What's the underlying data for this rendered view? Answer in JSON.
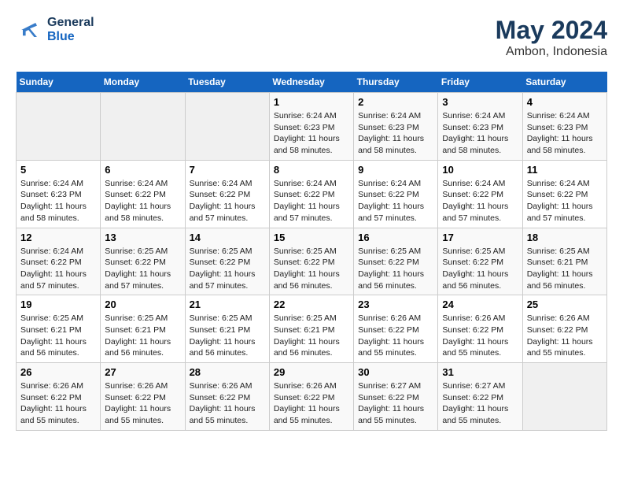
{
  "header": {
    "logo_general": "General",
    "logo_blue": "Blue",
    "title": "May 2024",
    "subtitle": "Ambon, Indonesia"
  },
  "weekdays": [
    "Sunday",
    "Monday",
    "Tuesday",
    "Wednesday",
    "Thursday",
    "Friday",
    "Saturday"
  ],
  "weeks": [
    [
      {
        "day": "",
        "info": ""
      },
      {
        "day": "",
        "info": ""
      },
      {
        "day": "",
        "info": ""
      },
      {
        "day": "1",
        "info": "Sunrise: 6:24 AM\nSunset: 6:23 PM\nDaylight: 11 hours and 58 minutes."
      },
      {
        "day": "2",
        "info": "Sunrise: 6:24 AM\nSunset: 6:23 PM\nDaylight: 11 hours and 58 minutes."
      },
      {
        "day": "3",
        "info": "Sunrise: 6:24 AM\nSunset: 6:23 PM\nDaylight: 11 hours and 58 minutes."
      },
      {
        "day": "4",
        "info": "Sunrise: 6:24 AM\nSunset: 6:23 PM\nDaylight: 11 hours and 58 minutes."
      }
    ],
    [
      {
        "day": "5",
        "info": "Sunrise: 6:24 AM\nSunset: 6:23 PM\nDaylight: 11 hours and 58 minutes."
      },
      {
        "day": "6",
        "info": "Sunrise: 6:24 AM\nSunset: 6:22 PM\nDaylight: 11 hours and 58 minutes."
      },
      {
        "day": "7",
        "info": "Sunrise: 6:24 AM\nSunset: 6:22 PM\nDaylight: 11 hours and 57 minutes."
      },
      {
        "day": "8",
        "info": "Sunrise: 6:24 AM\nSunset: 6:22 PM\nDaylight: 11 hours and 57 minutes."
      },
      {
        "day": "9",
        "info": "Sunrise: 6:24 AM\nSunset: 6:22 PM\nDaylight: 11 hours and 57 minutes."
      },
      {
        "day": "10",
        "info": "Sunrise: 6:24 AM\nSunset: 6:22 PM\nDaylight: 11 hours and 57 minutes."
      },
      {
        "day": "11",
        "info": "Sunrise: 6:24 AM\nSunset: 6:22 PM\nDaylight: 11 hours and 57 minutes."
      }
    ],
    [
      {
        "day": "12",
        "info": "Sunrise: 6:24 AM\nSunset: 6:22 PM\nDaylight: 11 hours and 57 minutes."
      },
      {
        "day": "13",
        "info": "Sunrise: 6:25 AM\nSunset: 6:22 PM\nDaylight: 11 hours and 57 minutes."
      },
      {
        "day": "14",
        "info": "Sunrise: 6:25 AM\nSunset: 6:22 PM\nDaylight: 11 hours and 57 minutes."
      },
      {
        "day": "15",
        "info": "Sunrise: 6:25 AM\nSunset: 6:22 PM\nDaylight: 11 hours and 56 minutes."
      },
      {
        "day": "16",
        "info": "Sunrise: 6:25 AM\nSunset: 6:22 PM\nDaylight: 11 hours and 56 minutes."
      },
      {
        "day": "17",
        "info": "Sunrise: 6:25 AM\nSunset: 6:22 PM\nDaylight: 11 hours and 56 minutes."
      },
      {
        "day": "18",
        "info": "Sunrise: 6:25 AM\nSunset: 6:21 PM\nDaylight: 11 hours and 56 minutes."
      }
    ],
    [
      {
        "day": "19",
        "info": "Sunrise: 6:25 AM\nSunset: 6:21 PM\nDaylight: 11 hours and 56 minutes."
      },
      {
        "day": "20",
        "info": "Sunrise: 6:25 AM\nSunset: 6:21 PM\nDaylight: 11 hours and 56 minutes."
      },
      {
        "day": "21",
        "info": "Sunrise: 6:25 AM\nSunset: 6:21 PM\nDaylight: 11 hours and 56 minutes."
      },
      {
        "day": "22",
        "info": "Sunrise: 6:25 AM\nSunset: 6:21 PM\nDaylight: 11 hours and 56 minutes."
      },
      {
        "day": "23",
        "info": "Sunrise: 6:26 AM\nSunset: 6:22 PM\nDaylight: 11 hours and 55 minutes."
      },
      {
        "day": "24",
        "info": "Sunrise: 6:26 AM\nSunset: 6:22 PM\nDaylight: 11 hours and 55 minutes."
      },
      {
        "day": "25",
        "info": "Sunrise: 6:26 AM\nSunset: 6:22 PM\nDaylight: 11 hours and 55 minutes."
      }
    ],
    [
      {
        "day": "26",
        "info": "Sunrise: 6:26 AM\nSunset: 6:22 PM\nDaylight: 11 hours and 55 minutes."
      },
      {
        "day": "27",
        "info": "Sunrise: 6:26 AM\nSunset: 6:22 PM\nDaylight: 11 hours and 55 minutes."
      },
      {
        "day": "28",
        "info": "Sunrise: 6:26 AM\nSunset: 6:22 PM\nDaylight: 11 hours and 55 minutes."
      },
      {
        "day": "29",
        "info": "Sunrise: 6:26 AM\nSunset: 6:22 PM\nDaylight: 11 hours and 55 minutes."
      },
      {
        "day": "30",
        "info": "Sunrise: 6:27 AM\nSunset: 6:22 PM\nDaylight: 11 hours and 55 minutes."
      },
      {
        "day": "31",
        "info": "Sunrise: 6:27 AM\nSunset: 6:22 PM\nDaylight: 11 hours and 55 minutes."
      },
      {
        "day": "",
        "info": ""
      }
    ]
  ]
}
